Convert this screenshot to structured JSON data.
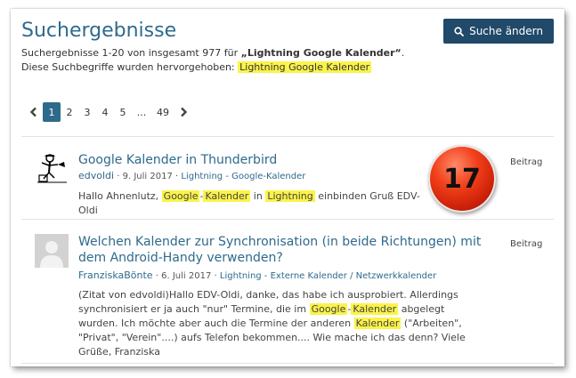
{
  "header": {
    "title": "Suchergebnisse",
    "edit_search_button": "Suche ändern"
  },
  "summary": {
    "line1_prefix": "Suchergebnisse 1-20 von insgesamt 977 für ",
    "query_quoted": "„Lightning Google Kalender“",
    "line1_suffix": ".",
    "line2_prefix": "Diese Suchbegriffe wurden hervorgehoben: ",
    "highlighted_terms": "Lightning Google Kalender"
  },
  "pagination": {
    "pages": [
      "1",
      "2",
      "3",
      "4",
      "5"
    ],
    "ellipsis": "...",
    "last": "49",
    "current": "1"
  },
  "results": [
    {
      "title": "Google Kalender in Thunderbird",
      "author": "edvoldi",
      "date": "9. Juli 2017",
      "forum": "Lightning - Google-Kalender",
      "type": "Beitrag",
      "excerpt": {
        "t1": "Hallo Ahnenlutz, ",
        "h1": "Google",
        "t2": "-",
        "h2": "Kalender",
        "t3": " in ",
        "h3": "Lightning",
        "t4": " einbinden Gruß EDV-Oldi"
      }
    },
    {
      "title": "Welchen Kalender zur Synchronisation (in beide Richtungen) mit dem Android-Handy verwenden?",
      "author": "FranziskaBönte",
      "date": "6. Juli 2017",
      "forum": "Lightning - Externe Kalender / Netzwerkkalender",
      "type": "Beitrag",
      "excerpt": {
        "t1": "(Zitat von edvoldi)Hallo EDV-Oldi, danke, das habe ich ausprobiert. Allerdings synchronisiert er ja auch \"nur\" Termine, die im ",
        "h1": "Google",
        "t2": "-",
        "h2": "Kalender",
        "t3": " abgelegt wurden. Ich möchte aber auch die Termine der anderen ",
        "h3": "Kalender",
        "t4": " (\"Arbeiten\", \"Privat\", \"Verein\"....) aufs Telefon bekommen.... Wie mache ich das denn? Viele Grüße, Franziska"
      }
    }
  ],
  "overlay_badge": "17",
  "colors": {
    "accent": "#2e6a8c",
    "button": "#20496a",
    "highlight": "#fbf34a",
    "badge": "#e0300f"
  },
  "icons": [
    "search-icon",
    "chevron-left-icon",
    "chevron-right-icon",
    "user-avatar-drawing",
    "default-avatar-icon"
  ]
}
